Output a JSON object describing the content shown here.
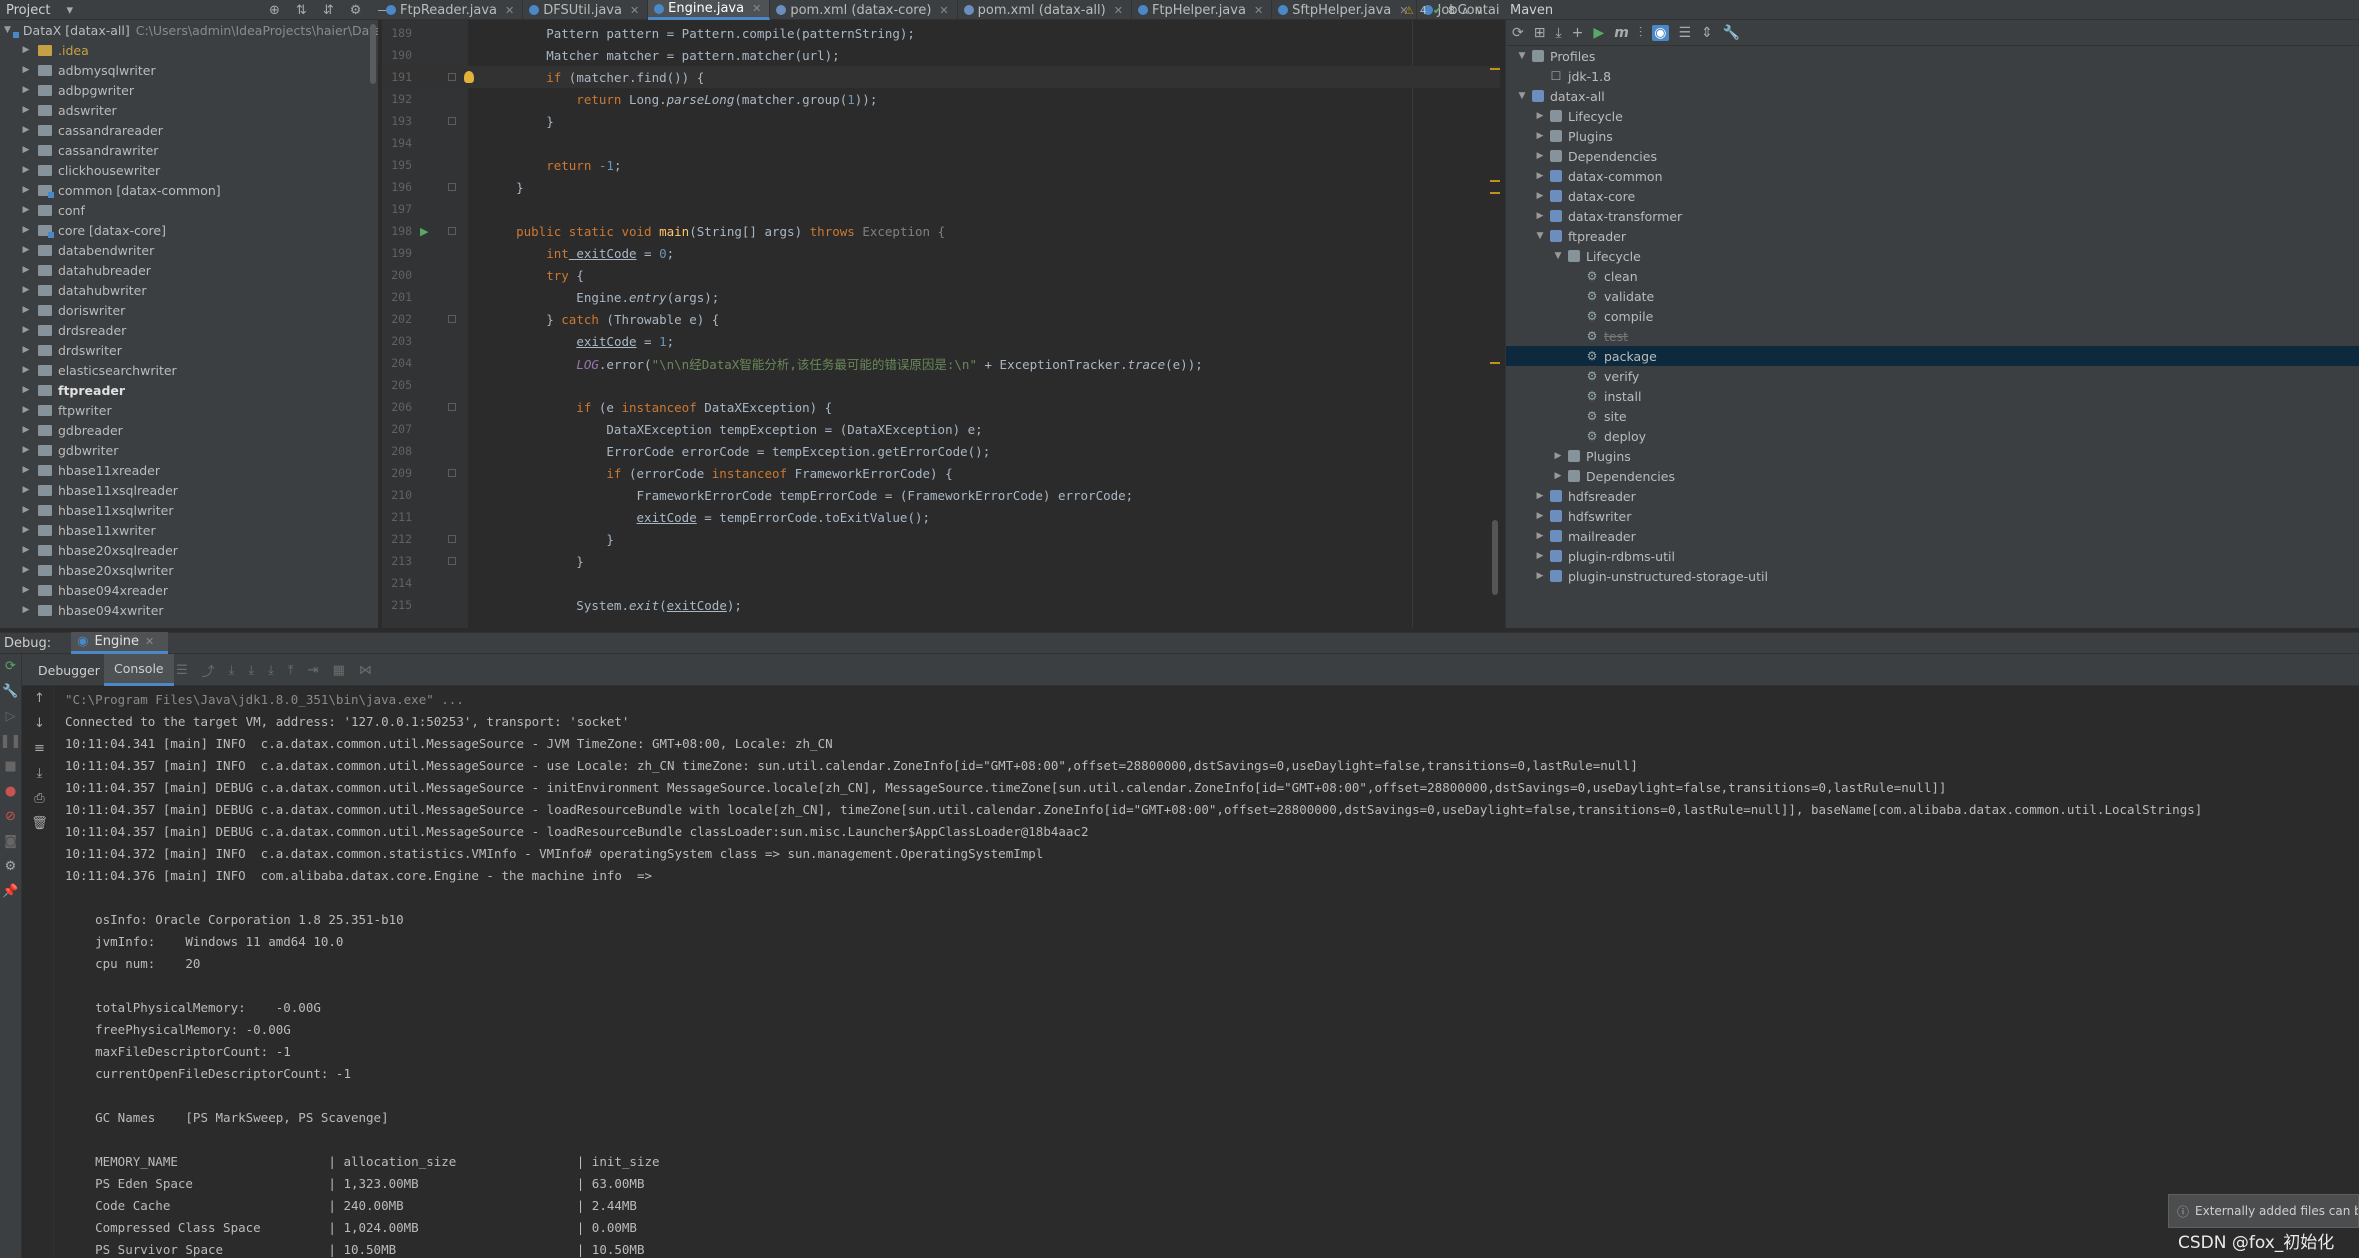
{
  "project_panel": {
    "title": "Project",
    "root_label": "DataX [datax-all]",
    "root_path": "C:\\Users\\admin\\IdeaProjects\\haier\\Data",
    "items": [
      {
        "label": ".idea",
        "style": "idea"
      },
      {
        "label": "adbmysqlwriter"
      },
      {
        "label": "adbpgwriter"
      },
      {
        "label": "adswriter"
      },
      {
        "label": "cassandrareader"
      },
      {
        "label": "cassandrawriter"
      },
      {
        "label": "clickhousewriter"
      },
      {
        "label": "common [datax-common]",
        "style": "module"
      },
      {
        "label": "conf"
      },
      {
        "label": "core [datax-core]",
        "style": "module"
      },
      {
        "label": "databendwriter"
      },
      {
        "label": "datahubreader"
      },
      {
        "label": "datahubwriter"
      },
      {
        "label": "doriswriter"
      },
      {
        "label": "drdsreader"
      },
      {
        "label": "drdswriter"
      },
      {
        "label": "elasticsearchwriter"
      },
      {
        "label": "ftpreader",
        "style": "bold"
      },
      {
        "label": "ftpwriter"
      },
      {
        "label": "gdbreader"
      },
      {
        "label": "gdbwriter"
      },
      {
        "label": "hbase11xreader"
      },
      {
        "label": "hbase11xsqlreader"
      },
      {
        "label": "hbase11xsqlwriter"
      },
      {
        "label": "hbase11xwriter"
      },
      {
        "label": "hbase20xsqlreader"
      },
      {
        "label": "hbase20xsqlwriter"
      },
      {
        "label": "hbase094xreader"
      },
      {
        "label": "hbase094xwriter"
      }
    ]
  },
  "editor_tabs": [
    {
      "label": "FtpReader.java",
      "color": "#4a88c7"
    },
    {
      "label": "DFSUtil.java",
      "color": "#4a88c7"
    },
    {
      "label": "Engine.java",
      "color": "#4a88c7",
      "active": true
    },
    {
      "label": "pom.xml (datax-core)",
      "color": "#6c8ebf"
    },
    {
      "label": "pom.xml (datax-all)",
      "color": "#6c8ebf"
    },
    {
      "label": "FtpHelper.java",
      "color": "#4a88c7"
    },
    {
      "label": "SftpHelper.java",
      "color": "#4a88c7"
    },
    {
      "label": "JobContai",
      "color": "#4a88c7"
    }
  ],
  "editor_status": {
    "warnings": "4",
    "ok": "8"
  },
  "editor": {
    "lines": [
      {
        "n": "189"
      },
      {
        "n": "190"
      },
      {
        "n": "191"
      },
      {
        "n": "192"
      },
      {
        "n": "193"
      },
      {
        "n": "194"
      },
      {
        "n": "195"
      },
      {
        "n": "196"
      },
      {
        "n": "197"
      },
      {
        "n": "198"
      },
      {
        "n": "199"
      },
      {
        "n": "200"
      },
      {
        "n": "201"
      },
      {
        "n": "202"
      },
      {
        "n": "203"
      },
      {
        "n": "204"
      },
      {
        "n": "205"
      },
      {
        "n": "206"
      },
      {
        "n": "207"
      },
      {
        "n": "208"
      },
      {
        "n": "209"
      },
      {
        "n": "210"
      },
      {
        "n": "211"
      },
      {
        "n": "212"
      },
      {
        "n": "213"
      },
      {
        "n": "214"
      },
      {
        "n": "215"
      }
    ],
    "code": {
      "l189": "        Pattern pattern = Pattern.compile(patternString);",
      "l190": "        Matcher matcher = pattern.matcher(url);",
      "l191a": "        if",
      "l191b": " (matcher.find()) {",
      "l192a": "            return",
      "l192b": " Long.",
      "l192c": "parseLong",
      "l192d": "(matcher.group(",
      "l192e": "1",
      "l192f": "));",
      "l193": "        }",
      "l195a": "        return",
      "l195b": " -1",
      "l195c": ";",
      "l196": "    }",
      "l198a": "    public static void",
      "l198b": " main",
      "l198c": "(String[] args) ",
      "l198d": "throws",
      "l198e": " Exception {",
      "l199a": "        int",
      "l199b": " exitCode",
      "l199c": " = ",
      "l199d": "0",
      "l199e": ";",
      "l200a": "        try",
      "l200b": " {",
      "l201a": "            Engine.",
      "l201b": "entry",
      "l201c": "(args);",
      "l202a": "        } ",
      "l202b": "catch",
      "l202c": " (Throwable e) {",
      "l203a": "            ",
      "l203b": "exitCode",
      "l203c": " = ",
      "l203d": "1",
      "l203e": ";",
      "l204a": "            ",
      "l204b": "LOG",
      "l204c": ".error(",
      "l204d": "\"\\n\\n经DataX智能分析,该任务最可能的错误原因是:\\n\"",
      "l204e": " + ExceptionTracker.",
      "l204f": "trace",
      "l204g": "(e));",
      "l206a": "            if",
      "l206b": " (e ",
      "l206c": "instanceof",
      "l206d": " DataXException) {",
      "l207": "                DataXException tempException = (DataXException) e;",
      "l208": "                ErrorCode errorCode = tempException.getErrorCode();",
      "l209a": "                if",
      "l209b": " (errorCode ",
      "l209c": "instanceof",
      "l209d": " FrameworkErrorCode) {",
      "l210": "                    FrameworkErrorCode tempErrorCode = (FrameworkErrorCode) errorCode;",
      "l211a": "                    ",
      "l211b": "exitCode",
      "l211c": " = tempErrorCode.toExitValue();",
      "l212": "                }",
      "l213": "            }",
      "l215a": "            System.",
      "l215b": "exit",
      "l215c": "(",
      "l215d": "exitCode",
      "l215e": ");",
      "l216": "        }"
    }
  },
  "maven": {
    "title": "Maven",
    "tree": [
      {
        "label": "Profiles",
        "indent": 0,
        "arrow": "down",
        "icon": "folder"
      },
      {
        "label": "jdk-1.8",
        "indent": 1,
        "arrow": "",
        "icon": "check"
      },
      {
        "label": "datax-all",
        "indent": 0,
        "arrow": "down",
        "icon": "module"
      },
      {
        "label": "Lifecycle",
        "indent": 1,
        "arrow": "right",
        "icon": "folder"
      },
      {
        "label": "Plugins",
        "indent": 1,
        "arrow": "right",
        "icon": "folder"
      },
      {
        "label": "Dependencies",
        "indent": 1,
        "arrow": "right",
        "icon": "folder"
      },
      {
        "label": "datax-common",
        "indent": 1,
        "arrow": "right",
        "icon": "module"
      },
      {
        "label": "datax-core",
        "indent": 1,
        "arrow": "right",
        "icon": "module"
      },
      {
        "label": "datax-transformer",
        "indent": 1,
        "arrow": "right",
        "icon": "module"
      },
      {
        "label": "ftpreader",
        "indent": 1,
        "arrow": "down",
        "icon": "module"
      },
      {
        "label": "Lifecycle",
        "indent": 2,
        "arrow": "down",
        "icon": "folder"
      },
      {
        "label": "clean",
        "indent": 3,
        "arrow": "",
        "icon": "gear"
      },
      {
        "label": "validate",
        "indent": 3,
        "arrow": "",
        "icon": "gear"
      },
      {
        "label": "compile",
        "indent": 3,
        "arrow": "",
        "icon": "gear"
      },
      {
        "label": "test",
        "indent": 3,
        "arrow": "",
        "icon": "gear",
        "dim": true
      },
      {
        "label": "package",
        "indent": 3,
        "arrow": "",
        "icon": "gear",
        "selected": true
      },
      {
        "label": "verify",
        "indent": 3,
        "arrow": "",
        "icon": "gear"
      },
      {
        "label": "install",
        "indent": 3,
        "arrow": "",
        "icon": "gear"
      },
      {
        "label": "site",
        "indent": 3,
        "arrow": "",
        "icon": "gear"
      },
      {
        "label": "deploy",
        "indent": 3,
        "arrow": "",
        "icon": "gear"
      },
      {
        "label": "Plugins",
        "indent": 2,
        "arrow": "right",
        "icon": "folder"
      },
      {
        "label": "Dependencies",
        "indent": 2,
        "arrow": "right",
        "icon": "folder"
      },
      {
        "label": "hdfsreader",
        "indent": 1,
        "arrow": "right",
        "icon": "module"
      },
      {
        "label": "hdfswriter",
        "indent": 1,
        "arrow": "right",
        "icon": "module"
      },
      {
        "label": "mailreader",
        "indent": 1,
        "arrow": "right",
        "icon": "module"
      },
      {
        "label": "plugin-rdbms-util",
        "indent": 1,
        "arrow": "right",
        "icon": "module"
      },
      {
        "label": "plugin-unstructured-storage-util",
        "indent": 1,
        "arrow": "right",
        "icon": "module"
      }
    ]
  },
  "debug": {
    "label": "Debug:",
    "run_tab": "Engine",
    "sub_tabs": [
      "Debugger",
      "Console"
    ]
  },
  "console_lines": [
    "\"C:\\Program Files\\Java\\jdk1.8.0_351\\bin\\java.exe\" ...",
    "Connected to the target VM, address: '127.0.0.1:50253', transport: 'socket'",
    "10:11:04.341 [main] INFO  c.a.datax.common.util.MessageSource - JVM TimeZone: GMT+08:00, Locale: zh_CN",
    "10:11:04.357 [main] INFO  c.a.datax.common.util.MessageSource - use Locale: zh_CN timeZone: sun.util.calendar.ZoneInfo[id=\"GMT+08:00\",offset=28800000,dstSavings=0,useDaylight=false,transitions=0,lastRule=null]",
    "10:11:04.357 [main] DEBUG c.a.datax.common.util.MessageSource - initEnvironment MessageSource.locale[zh_CN], MessageSource.timeZone[sun.util.calendar.ZoneInfo[id=\"GMT+08:00\",offset=28800000,dstSavings=0,useDaylight=false,transitions=0,lastRule=null]]",
    "10:11:04.357 [main] DEBUG c.a.datax.common.util.MessageSource - loadResourceBundle with locale[zh_CN], timeZone[sun.util.calendar.ZoneInfo[id=\"GMT+08:00\",offset=28800000,dstSavings=0,useDaylight=false,transitions=0,lastRule=null]], baseName[com.alibaba.datax.common.util.LocalStrings]",
    "10:11:04.357 [main] DEBUG c.a.datax.common.util.MessageSource - loadResourceBundle classLoader:sun.misc.Launcher$AppClassLoader@18b4aac2",
    "10:11:04.372 [main] INFO  c.a.datax.common.statistics.VMInfo - VMInfo# operatingSystem class => sun.management.OperatingSystemImpl",
    "10:11:04.376 [main] INFO  com.alibaba.datax.core.Engine - the machine info  =>",
    "",
    "    osInfo: Oracle Corporation 1.8 25.351-b10",
    "    jvmInfo:    Windows 11 amd64 10.0",
    "    cpu num:    20",
    "",
    "    totalPhysicalMemory:    -0.00G",
    "    freePhysicalMemory: -0.00G",
    "    maxFileDescriptorCount: -1",
    "    currentOpenFileDescriptorCount: -1",
    "",
    "    GC Names    [PS MarkSweep, PS Scavenge]",
    "",
    "    MEMORY_NAME                    | allocation_size                | init_size",
    "    PS Eden Space                  | 1,323.00MB                     | 63.00MB",
    "    Code Cache                     | 240.00MB                       | 2.44MB",
    "    Compressed Class Space         | 1,024.00MB                     | 0.00MB",
    "    PS Survivor Space              | 10.50MB                        | 10.50MB"
  ],
  "notification": "Externally added files can b",
  "watermark": "CSDN @fox_初始化"
}
